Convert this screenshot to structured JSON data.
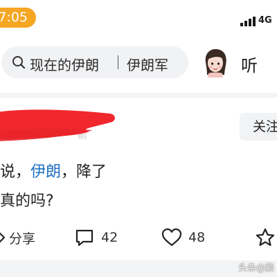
{
  "status_bar": {
    "time": "7:05",
    "network": "4G"
  },
  "search": {
    "query": "现在的伊朗",
    "hot_term": "伊朗军"
  },
  "header": {
    "listen_label": "听"
  },
  "post": {
    "follow_label": "关注",
    "text_line1_parts": [
      "说，",
      "伊朗",
      "，降了"
    ],
    "text_line2": "真的吗?",
    "keyword_color": "#1f6fc1"
  },
  "actions": {
    "share_label": "分享",
    "comment_count": "42",
    "like_count": "48"
  },
  "watermark": "头条@鹏",
  "colors": {
    "accent": "#f5a623",
    "redaction": "#f0282e"
  },
  "icons": {
    "search": "search-icon",
    "share": "share-icon",
    "comment": "comment-icon",
    "like": "heart-icon",
    "favorite": "star-icon"
  }
}
